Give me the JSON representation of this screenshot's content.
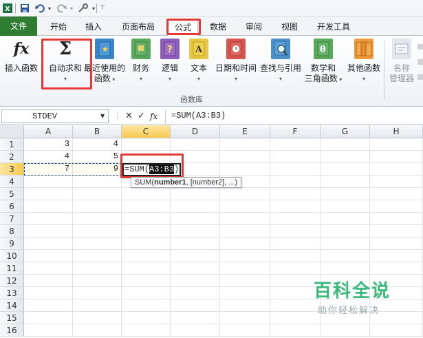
{
  "quick_access": {
    "save_icon": "save-icon",
    "undo_icon": "undo-icon",
    "redo_icon": "redo-icon",
    "customize_icon": "customize-icon"
  },
  "tabs": {
    "file": "文件",
    "home": "开始",
    "insert": "插入",
    "page_layout": "页面布局",
    "formulas": "公式",
    "data": "数据",
    "review": "审阅",
    "view": "视图",
    "developer": "开发工具"
  },
  "ribbon": {
    "insert_function": "插入函数",
    "autosum": "自动求和",
    "recently_used_1": "最近使用的",
    "recently_used_2": "函数",
    "financial": "财务",
    "logical": "逻辑",
    "text": "文本",
    "date_time": "日期和时间",
    "lookup_reference": "查找与引用",
    "math_trig_1": "数学和",
    "math_trig_2": "三角函数",
    "more_functions": "其他函数",
    "name_manager_1": "名称",
    "name_manager_2": "管理器",
    "group_label": "函数库",
    "fx_glyph": "fx",
    "sigma_glyph": "Σ"
  },
  "formula_bar": {
    "name_box": "STDEV",
    "formula": "=SUM(A3:B3)",
    "cancel_glyph": "✕",
    "enter_glyph": "✓",
    "fx_glyph": "fx"
  },
  "grid": {
    "columns": [
      "A",
      "B",
      "C",
      "D",
      "E",
      "F",
      "G",
      "H"
    ],
    "rows": [
      "1",
      "2",
      "3",
      "4",
      "5",
      "6",
      "7",
      "8",
      "9",
      "10",
      "11",
      "12",
      "13",
      "14",
      "15",
      "16"
    ],
    "cells": {
      "A1": "3",
      "B1": "4",
      "A2": "4",
      "B2": "5",
      "A3": "7",
      "B3": "9"
    },
    "edit_prefix": "=SUM(",
    "edit_ref": "A3:B3",
    "edit_suffix": ")",
    "tooltip_fn": "SUM(",
    "tooltip_arg1": "number1",
    "tooltip_rest": ", [number2], ...)"
  },
  "watermark": {
    "title": "百科全说",
    "subtitle": "助你轻松解决"
  },
  "colors": {
    "accent_red": "#e53935",
    "file_tab": "#2f7d32",
    "watermark_green": "#39b97a"
  }
}
